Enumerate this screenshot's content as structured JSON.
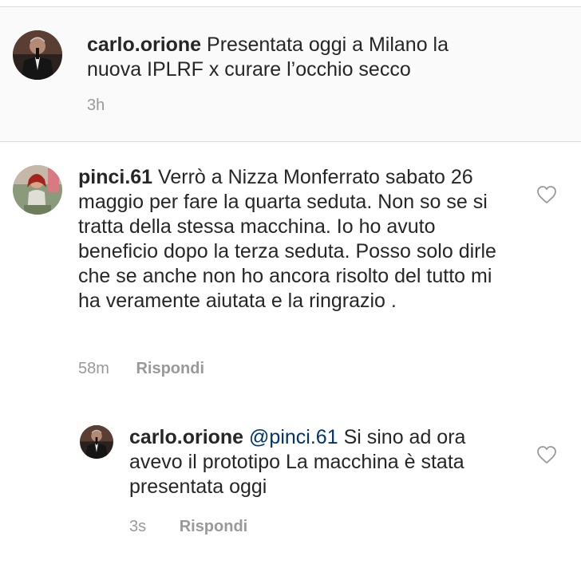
{
  "caption": {
    "username": "carlo.orione",
    "text": "Presentata oggi a Milano la nuova IPLRF x curare l’occhio secco",
    "time": "3h",
    "avatar_icon": "profile-photo"
  },
  "comment": {
    "username": "pinci.61",
    "text": "Verrò a Nizza Monferrato sabato 26 maggio per fare la quarta seduta. Non so se si tratta della stessa macchina. Io ho avuto beneficio dopo la terza seduta. Posso solo dirle che se anche non ho ancora risolto del tutto mi ha veramente aiutata e la ringrazio .",
    "time": "58m",
    "reply_label": "Rispondi",
    "like_icon": "heart-outline-icon"
  },
  "reply": {
    "username": "carlo.orione",
    "mention": "@pinci.61",
    "text": "Si sino ad ora avevo il prototipo La macchina è stata presentata oggi",
    "time": "3s",
    "reply_label": "Rispondi",
    "like_icon": "heart-outline-icon"
  },
  "colors": {
    "text": "#262626",
    "muted": "#999999",
    "mention": "#003569",
    "caption_bg": "#fafafa",
    "divider": "#dbdbdb"
  }
}
